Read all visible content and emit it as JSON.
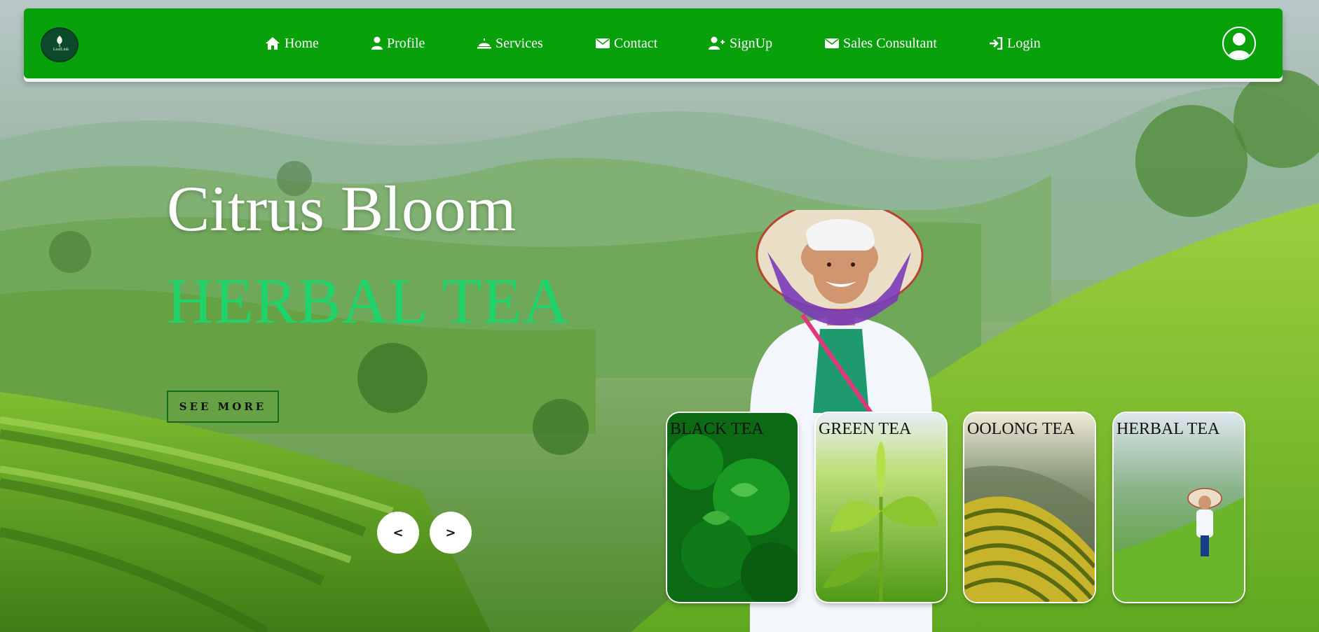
{
  "nav": {
    "logo_text": "LeafLink",
    "items": [
      {
        "label": "Home",
        "icon": "home-icon"
      },
      {
        "label": "Profile",
        "icon": "user-icon"
      },
      {
        "label": "Services",
        "icon": "bell-service-icon"
      },
      {
        "label": "Contact",
        "icon": "envelope-icon"
      },
      {
        "label": "SignUp",
        "icon": "user-plus-icon"
      },
      {
        "label": "Sales Consultant",
        "icon": "envelope-icon"
      },
      {
        "label": "Login",
        "icon": "sign-in-icon"
      }
    ],
    "avatar_icon": "user-circle-icon"
  },
  "hero": {
    "title": "Citrus Bloom",
    "subtitle": "HERBAL TEA",
    "button_label": "SEE MORE",
    "prev_label": "<",
    "next_label": ">"
  },
  "cards": [
    {
      "label": "BLACK TEA"
    },
    {
      "label": "GREEN TEA"
    },
    {
      "label": "OOLONG TEA"
    },
    {
      "label": "HERBAL TEA"
    }
  ],
  "colors": {
    "nav_bg": "#08a10b",
    "subtitle": "#1fd36a",
    "button_border": "#166b18"
  }
}
